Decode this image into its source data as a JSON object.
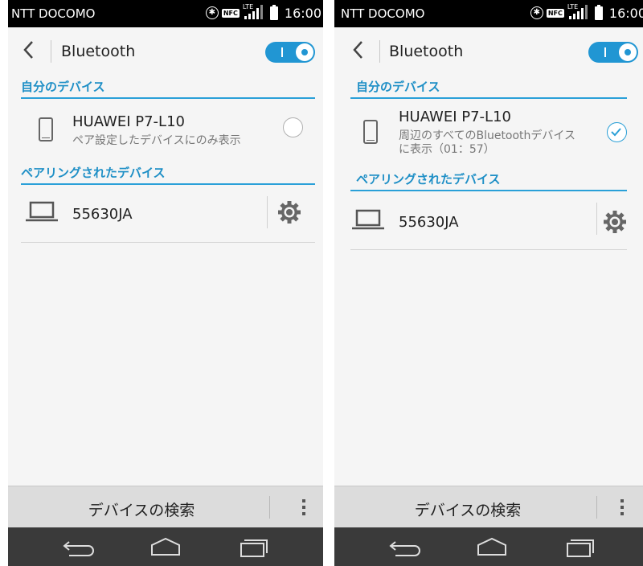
{
  "screens": [
    {
      "status_bar": {
        "carrier": "NTT DOCOMO",
        "nfc": "NFC",
        "lte": "LTE",
        "time": "16:00"
      },
      "header": {
        "title": "Bluetooth",
        "toggle_state": "on"
      },
      "my_device_section": {
        "title": "自分のデバイス"
      },
      "my_device": {
        "name": "HUAWEI P7-L10",
        "subtitle_line1": "ペア設定したデバイスにのみ表示",
        "subtitle_line2": "",
        "visible_checked": false
      },
      "paired_section": {
        "title": "ペアリングされたデバイス"
      },
      "paired_devices": [
        {
          "name": "55630JA",
          "icon": "laptop-icon",
          "settings_icon": "gear-icon"
        }
      ],
      "bottom_bar": {
        "search_label": "デバイスの検索",
        "menu_icon": "overflow-menu-icon"
      },
      "nav_bar": {
        "icons": [
          "back-icon",
          "home-icon",
          "recent-apps-icon"
        ]
      }
    },
    {
      "status_bar": {
        "carrier": "NTT DOCOMO",
        "nfc": "NFC",
        "lte": "LTE",
        "time": "16:00"
      },
      "header": {
        "title": "Bluetooth",
        "toggle_state": "on"
      },
      "my_device_section": {
        "title": "自分のデバイス"
      },
      "my_device": {
        "name": "HUAWEI P7-L10",
        "subtitle_line1": "周辺のすべてのBluetoothデバイス",
        "subtitle_line2": "に表示（01：57）",
        "visible_checked": true
      },
      "paired_section": {
        "title": "ペアリングされたデバイス"
      },
      "paired_devices": [
        {
          "name": "55630JA",
          "icon": "laptop-icon",
          "settings_icon": "gear-icon"
        }
      ],
      "bottom_bar": {
        "search_label": "デバイスの検索",
        "menu_icon": "overflow-menu-icon"
      },
      "nav_bar": {
        "icons": [
          "back-icon",
          "home-icon",
          "recent-apps-icon"
        ]
      }
    }
  ],
  "colors": {
    "accent": "#1e8fc6",
    "toggle": "#2196d3",
    "status_bar": "#000000",
    "nav_bar": "#3a3a3a",
    "bottom_bar": "#dcdcdc",
    "background": "#f5f5f5"
  }
}
